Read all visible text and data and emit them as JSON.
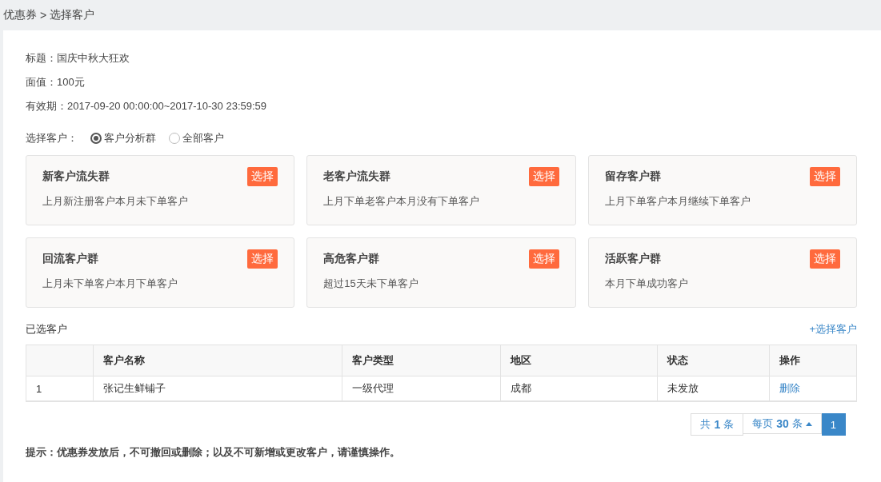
{
  "breadcrumb": {
    "parent": "优惠券",
    "separator": ">",
    "current": "选择客户"
  },
  "info": [
    {
      "label": "标题：",
      "value": "国庆中秋大狂欢"
    },
    {
      "label": "面值：",
      "value": "100元"
    },
    {
      "label": "有效期：",
      "value": "2017-09-20 00:00:00~2017-10-30 23:59:59"
    }
  ],
  "customer_choice": {
    "label": "选择客户：",
    "options": [
      {
        "label": "客户分析群",
        "selected": true
      },
      {
        "label": "全部客户",
        "selected": false
      }
    ]
  },
  "groups": [
    {
      "title": "新客户流失群",
      "description": "上月新注册客户本月未下单客户",
      "button": "选择"
    },
    {
      "title": "老客户流失群",
      "description": "上月下单老客户本月没有下单客户",
      "button": "选择"
    },
    {
      "title": "留存客户群",
      "description": "上月下单客户本月继续下单客户",
      "button": "选择"
    },
    {
      "title": "回流客户群",
      "description": "上月未下单客户本月下单客户",
      "button": "选择"
    },
    {
      "title": "高危客户群",
      "description": "超过15天未下单客户",
      "button": "选择"
    },
    {
      "title": "活跃客户群",
      "description": "本月下单成功客户",
      "button": "选择"
    }
  ],
  "selected_section": {
    "title": "已选客户",
    "add_link": "+选择客户"
  },
  "table": {
    "columns": [
      "客户名称",
      "客户类型",
      "地区",
      "状态",
      "操作"
    ],
    "rows": [
      {
        "index": "1",
        "name": "张记生鲜铺子",
        "type": "一级代理",
        "region": "成都",
        "status": "未发放",
        "action": "删除"
      }
    ]
  },
  "pagination": {
    "total": "共 **1** 条",
    "page_size": "每页 **30** 条",
    "pages": [
      {
        "label": "1",
        "selected": true
      }
    ]
  },
  "notice": "提示：优惠券发放后，不可撤回或删除；以及不可新增或更改客户，请谨慎操作。"
}
